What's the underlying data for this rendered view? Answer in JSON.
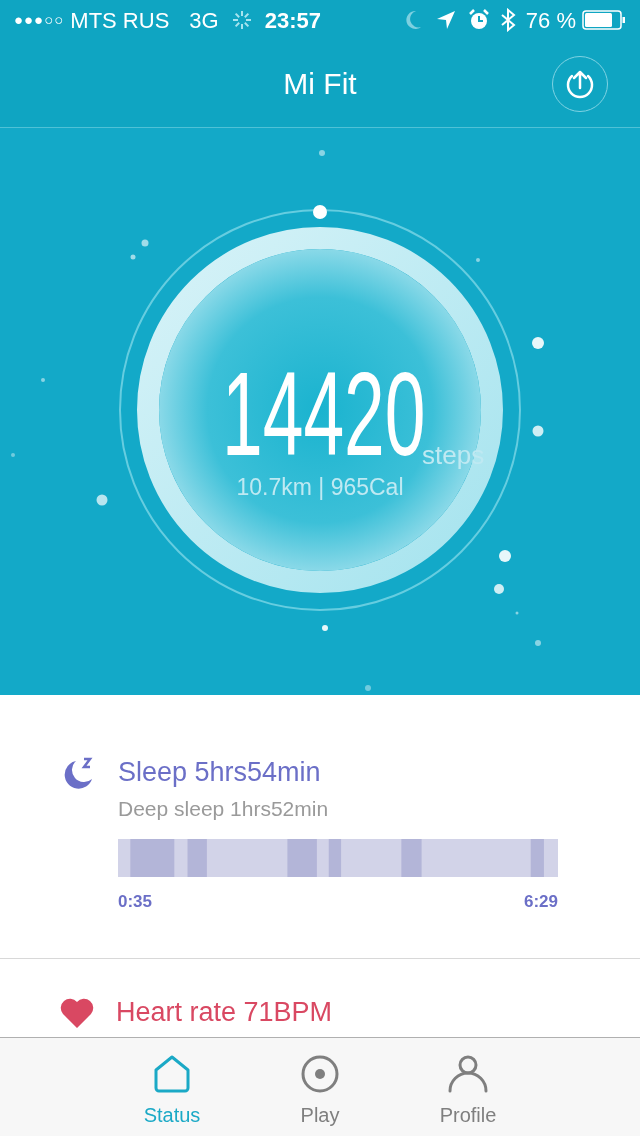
{
  "status_bar": {
    "signal_dots": "●●●○○",
    "carrier": "MTS RUS",
    "network": "3G",
    "time": "23:57",
    "battery": "76 %"
  },
  "header": {
    "title": "Mi Fit"
  },
  "activity": {
    "steps": "14420",
    "unit": "steps",
    "summary": "10.7km | 965Cal"
  },
  "sleep": {
    "title": "Sleep 5hrs54min",
    "deep": "Deep sleep 1hrs52min",
    "start": "0:35",
    "end": "6:29"
  },
  "heart": {
    "title": "Heart rate 71BPM"
  },
  "tabs": [
    {
      "label": "Status",
      "kind": "home",
      "selected": true
    },
    {
      "label": "Play",
      "kind": "play",
      "selected": false
    },
    {
      "label": "Profile",
      "kind": "profile",
      "selected": false
    }
  ]
}
